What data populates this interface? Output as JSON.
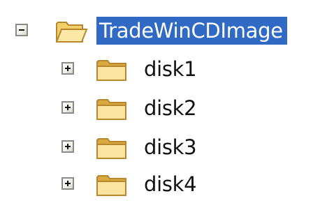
{
  "tree": {
    "root": {
      "label": "TradeWinCDImage",
      "expanded": true,
      "selected": true,
      "expander_icon": "minus-box-icon",
      "icon": "folder-open-icon"
    },
    "children": [
      {
        "label": "disk1",
        "expanded": false,
        "expander_icon": "plus-box-icon",
        "icon": "folder-icon"
      },
      {
        "label": "disk2",
        "expanded": false,
        "expander_icon": "plus-box-icon",
        "icon": "folder-icon"
      },
      {
        "label": "disk3",
        "expanded": false,
        "expander_icon": "plus-box-icon",
        "icon": "folder-icon"
      },
      {
        "label": "disk4",
        "expanded": false,
        "expander_icon": "plus-box-icon",
        "icon": "folder-icon"
      }
    ],
    "colors": {
      "selection_bg": "#316ac5",
      "selection_text": "#ffffff",
      "folder_light": "#fbe8a6",
      "folder_dark": "#d8a93e",
      "folder_outline": "#b8862c"
    }
  }
}
